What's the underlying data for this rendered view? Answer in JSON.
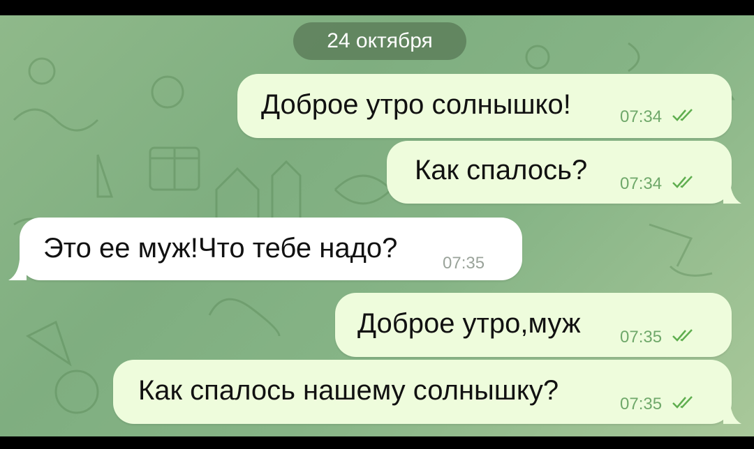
{
  "date_label": "24 октября",
  "messages": [
    {
      "direction": "out",
      "text": "Доброе утро солнышко!",
      "time": "07:34",
      "status": "read-double-check"
    },
    {
      "direction": "out",
      "text": "Как спалось?",
      "time": "07:34",
      "status": "read-double-check"
    },
    {
      "direction": "in",
      "text": "Это ее муж!Что тебе надо?",
      "time": "07:35"
    },
    {
      "direction": "out",
      "text": "Доброе утро,муж",
      "time": "07:35",
      "status": "read-double-check"
    },
    {
      "direction": "out",
      "text": "Как спалось нашему солнышку?",
      "time": "07:35",
      "status": "read-double-check"
    }
  ],
  "colors": {
    "outgoing_bubble": "#eefcdc",
    "incoming_bubble": "#ffffff",
    "read_ticks": "#5fae4f",
    "chat_background": "#86b486"
  },
  "icons": {
    "read_status": "double-check-icon"
  }
}
